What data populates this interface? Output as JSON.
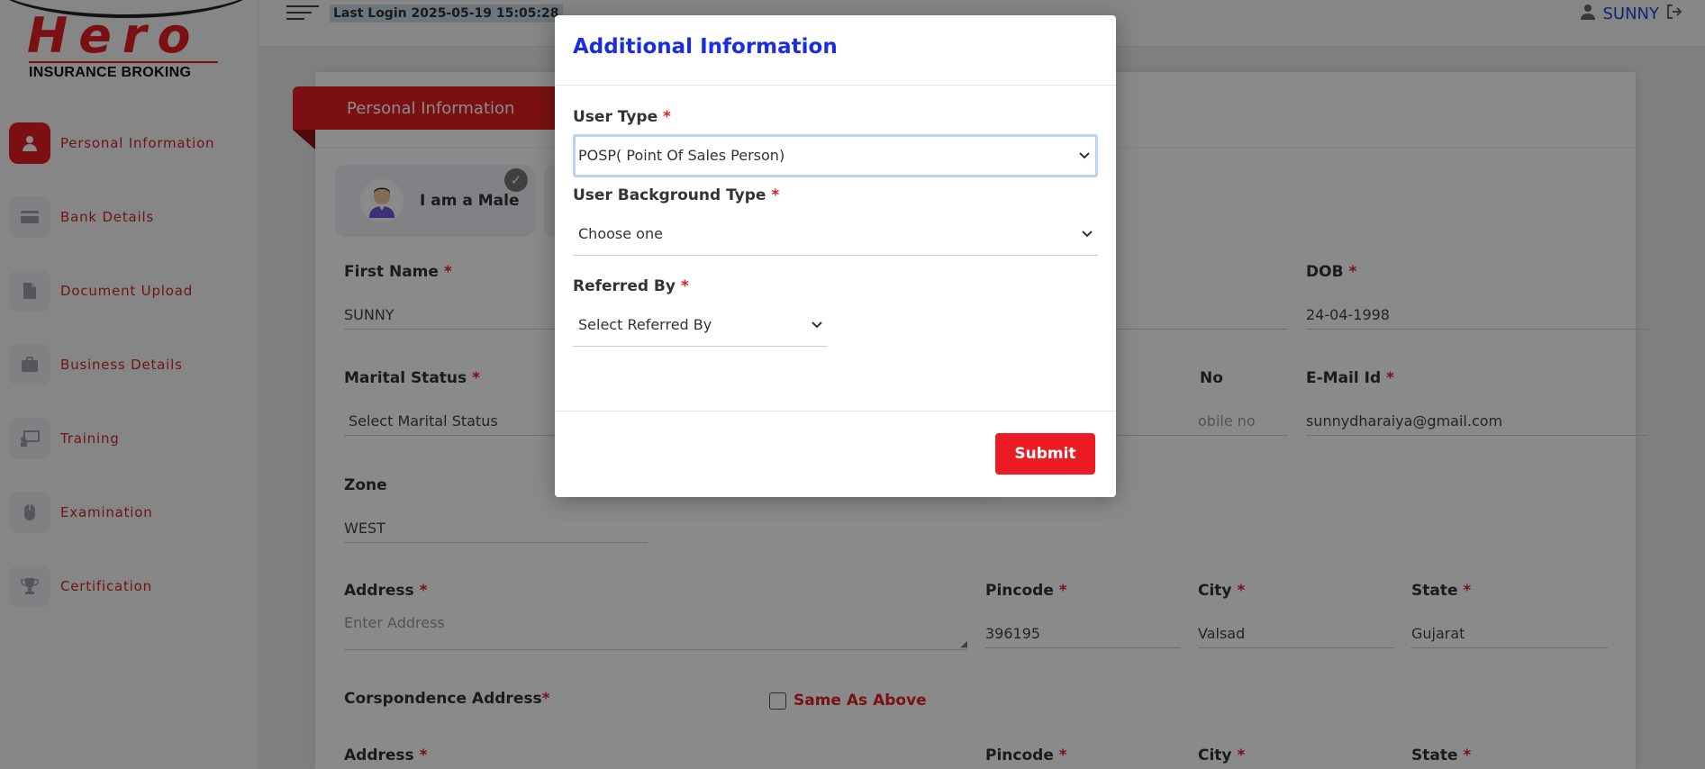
{
  "logo": {
    "brand": "Hero",
    "subtitle": "INSURANCE BROKING"
  },
  "header": {
    "last_login": "Last Login 2025-05-19 15:05:28",
    "username": "SUNNY"
  },
  "sidebar": {
    "items": [
      {
        "label": "Personal Information",
        "icon": "user-icon"
      },
      {
        "label": "Bank Details",
        "icon": "credit-card-icon"
      },
      {
        "label": "Document Upload",
        "icon": "pdf-file-icon"
      },
      {
        "label": "Business Details",
        "icon": "briefcase-icon"
      },
      {
        "label": "Training",
        "icon": "presentation-icon"
      },
      {
        "label": "Examination",
        "icon": "mouse-icon"
      },
      {
        "label": "Certification",
        "icon": "trophy-icon"
      }
    ]
  },
  "form": {
    "tab": "Personal Information",
    "gender_label": "I am a Male",
    "first_name": {
      "label": "First Name",
      "value": "SUNNY"
    },
    "dob": {
      "label": "DOB",
      "value": "24-04-1998"
    },
    "marital_status": {
      "label": "Marital Status",
      "value": "Select Marital Status"
    },
    "mobile": {
      "label": "No",
      "placeholder": "obile no"
    },
    "email": {
      "label": "E-Mail Id",
      "value": "sunnydharaiya@gmail.com"
    },
    "zone": {
      "label": "Zone",
      "value": "WEST"
    },
    "address": {
      "label": "Address",
      "placeholder": "Enter Address"
    },
    "pincode": {
      "label": "Pincode",
      "value": "396195"
    },
    "city": {
      "label": "City",
      "value": "Valsad"
    },
    "state": {
      "label": "State",
      "value": "Gujarat"
    },
    "corr_address": {
      "label": "Corspondence Address"
    },
    "same_as_above": "Same As Above",
    "corr_address_label": "Address",
    "corr_pincode_label": "Pincode",
    "corr_city_label": "City",
    "corr_state_label": "State"
  },
  "modal": {
    "title": "Additional Information",
    "user_type": {
      "label": "User Type",
      "value": "POSP( Point Of Sales Person)"
    },
    "background_type": {
      "label": "User Background Type",
      "value": "Choose one"
    },
    "referred_by": {
      "label": "Referred By",
      "value": "Select Referred By"
    },
    "submit": "Submit"
  },
  "colors": {
    "brand_red": "#e31e24",
    "modal_title_blue": "#1a2de0"
  }
}
